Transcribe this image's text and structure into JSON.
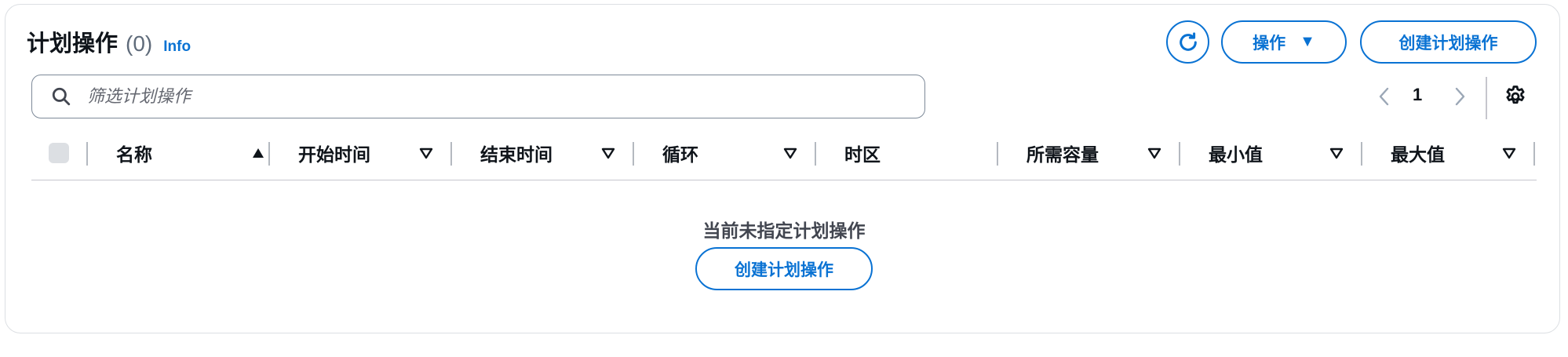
{
  "header": {
    "title": "计划操作",
    "count": "(0)",
    "info": "Info"
  },
  "toolbar": {
    "refresh_icon": "refresh-icon",
    "actions_label": "操作",
    "create_label": "创建计划操作"
  },
  "search": {
    "placeholder": "筛选计划操作",
    "value": ""
  },
  "pagination": {
    "current_page": "1"
  },
  "table": {
    "columns": [
      {
        "label": "名称",
        "sort": "ascending"
      },
      {
        "label": "开始时间",
        "sort": "none"
      },
      {
        "label": "结束时间",
        "sort": "none"
      },
      {
        "label": "循环",
        "sort": "none"
      },
      {
        "label": "时区",
        "sort": "disabled"
      },
      {
        "label": "所需容量",
        "sort": "none"
      },
      {
        "label": "最小值",
        "sort": "none"
      },
      {
        "label": "最大值",
        "sort": "none"
      }
    ],
    "rows": []
  },
  "empty_state": {
    "message": "当前未指定计划操作",
    "button_label": "创建计划操作"
  },
  "colors": {
    "accent": "#0972d3",
    "text": "#0f141a",
    "border": "#c6c6cd"
  }
}
